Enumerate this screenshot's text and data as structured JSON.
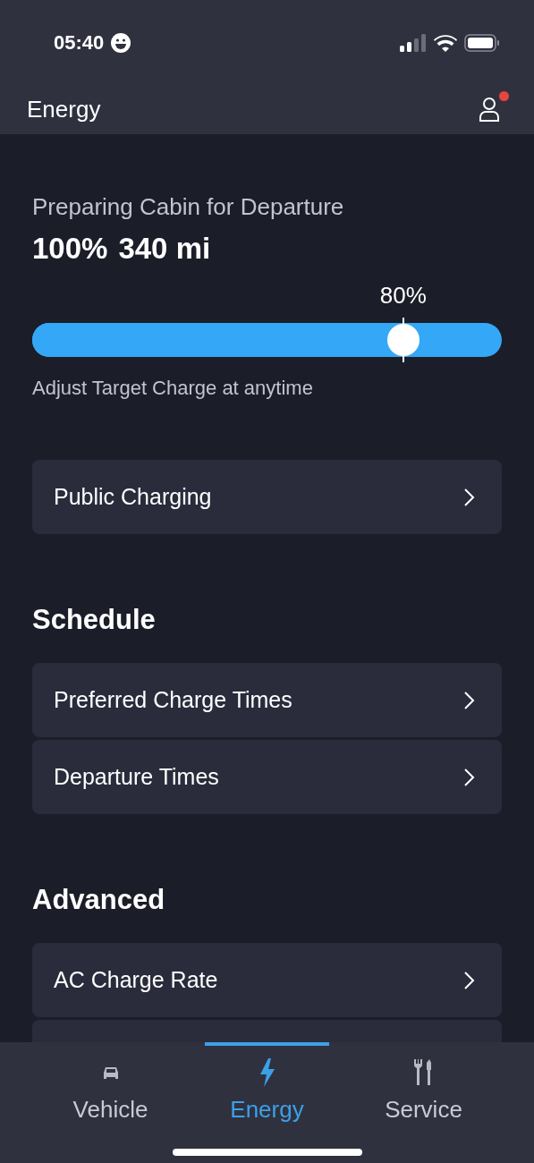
{
  "status_bar": {
    "time": "05:40"
  },
  "header": {
    "title": "Energy",
    "notification": true
  },
  "charge": {
    "status": "Preparing Cabin for Departure",
    "battery": "100%",
    "range": "340 mi",
    "target_label": "80%",
    "level": 0.79,
    "hint": "Adjust Target Charge at anytime"
  },
  "sections": [
    {
      "items": [
        {
          "label": "Public Charging"
        }
      ]
    },
    {
      "title": "Schedule",
      "items": [
        {
          "label": "Preferred Charge Times"
        },
        {
          "label": "Departure Times"
        }
      ]
    },
    {
      "title": "Advanced",
      "items": [
        {
          "label": "AC Charge Rate"
        }
      ],
      "more_below": true
    }
  ],
  "tabs": [
    {
      "label": "Vehicle",
      "kind": "car",
      "selected": false
    },
    {
      "label": "Energy",
      "kind": "bolt",
      "selected": true
    },
    {
      "label": "Service",
      "kind": "tools",
      "selected": false
    }
  ]
}
